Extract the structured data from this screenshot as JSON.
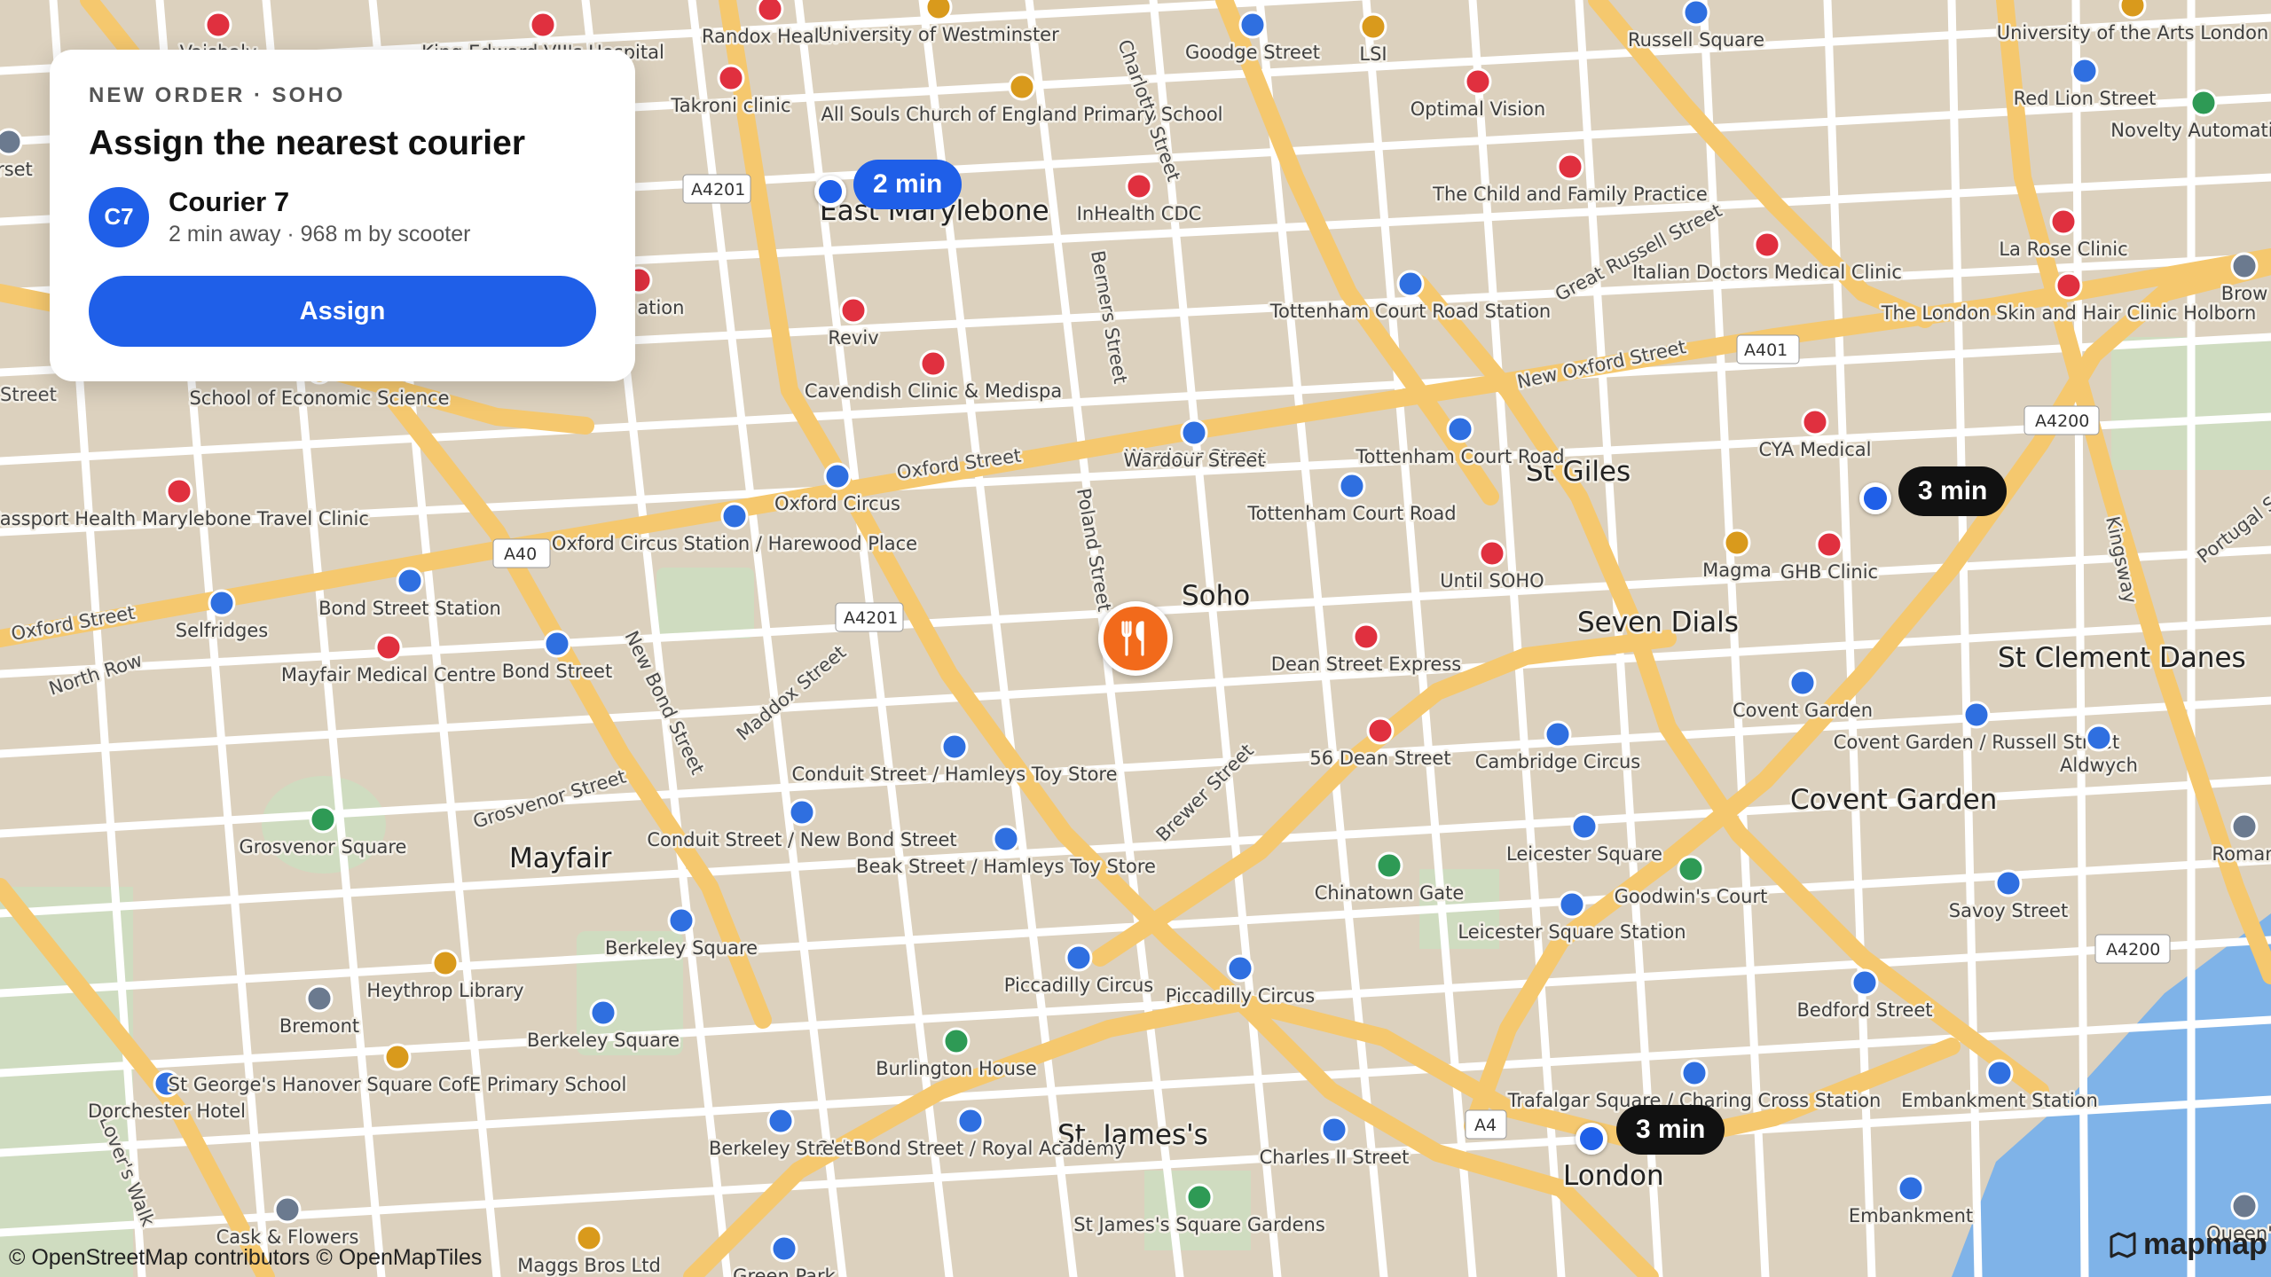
{
  "order_card": {
    "eyebrow": "NEW ORDER · SOHO",
    "title": "Assign the nearest courier",
    "courier": {
      "initials": "C7",
      "name": "Courier 7",
      "detail": "2 min away · 968 m by scooter"
    },
    "assign_label": "Assign"
  },
  "markers": {
    "restaurant_icon": "fork-knife-icon",
    "couriers": [
      {
        "eta": "2 min",
        "style": "selected",
        "color": "#1f5fe8"
      },
      {
        "eta": "3 min",
        "style": "default",
        "color": "#111111"
      },
      {
        "eta": "3 min",
        "style": "default",
        "color": "#111111"
      }
    ]
  },
  "map": {
    "areas": [
      "Soho",
      "Mayfair",
      "St Giles",
      "Seven Dials",
      "Covent Garden",
      "St Clement Danes",
      "St. James's",
      "London",
      "East Marylebone"
    ],
    "streets": [
      "Oxford Street",
      "New Oxford Street",
      "Great Russell Street",
      "Charlotte Street",
      "Berners Street",
      "Wardour Street",
      "Poland Street",
      "Brewer Street",
      "Maddox Street",
      "Grosvenor Street",
      "New Bond Street",
      "North Row",
      "Kingsway",
      "Lover's Walk",
      "Portugal St",
      "Street"
    ],
    "road_shields": [
      "A4201",
      "A40",
      "A4201",
      "A401",
      "A4200",
      "A4200",
      "A4"
    ],
    "stations": [
      "Goodge Street",
      "Tottenham Court Road Station",
      "Wardour Street",
      "Tottenham Court Road",
      "Tottenham Court Road",
      "Oxford Circus",
      "Oxford Circus Station / Harewood Place",
      "Bond Street Station",
      "Bond Street",
      "Conduit Street / Hamleys Toy Store",
      "Conduit Street / New Bond Street",
      "Beak Street / Hamleys Toy Store",
      "Piccadilly Circus",
      "Piccadilly Circus",
      "Cambridge Circus",
      "Leicester Square",
      "Leicester Square Station",
      "Covent Garden",
      "Covent Garden / Russell Street",
      "Aldwych",
      "Savoy Street",
      "Bedford Street",
      "Embankment Station",
      "Embankment",
      "Trafalgar Square / Charing Cross Station",
      "Charles II Street",
      "Old Bond Street / Royal Academy",
      "Berkeley Street",
      "Berkeley Square",
      "Berkeley Square",
      "Dorchester Hotel",
      "Selfridges",
      "Red Lion Street",
      "Russell Square",
      "Green Park"
    ],
    "health": [
      "Randox Health",
      "King Edward VII's Hospital",
      "Vaishaly",
      "Takroni clinic",
      "InHealth CDC",
      "Reviv",
      "Cavendish Clinic & Medispa",
      "Passport Health Marylebone Travel Clinic",
      "Mayfair Medical Centre",
      "Optimal Vision",
      "The Child and Family Practice",
      "Italian Doctors Medical Clinic",
      "La Rose Clinic",
      "The London Skin and Hair Clinic Holborn",
      "CYA Medical",
      "GHB Clinic",
      "Until SOHO",
      "Dean Street Express",
      "56 Dean Street",
      "Hair ation"
    ],
    "education": [
      "University of Westminster",
      "LSI",
      "All Souls Church of England Primary School",
      "Magma",
      "Heythrop Library",
      "St George's Hanover Square CofE Primary School",
      "Maggs Bros Ltd",
      "University of the Arts London",
      "School of Economic Science"
    ],
    "parks": [
      "Grosvenor Square",
      "Chinatown Gate",
      "Goodwin's Court",
      "Burlington House",
      "St James's Square Gardens",
      "Novelty Automation"
    ],
    "misc": [
      "Bremont",
      "Cask & Flowers",
      "Brow",
      "Roman",
      "Queen's",
      "orset"
    ]
  },
  "attribution": "© OpenStreetMap contributors © OpenMapTiles",
  "brand": {
    "name": "mapmap",
    "icon": "mapmap-logo-icon"
  },
  "colors": {
    "accent": "#1f5fe8",
    "restaurant": "#f26a1b",
    "health": "#e0303f",
    "station": "#2f6fe0",
    "education": "#d99a1c",
    "park": "#2e9a55",
    "major_road": "#f5c86e",
    "water": "#7fb3e8"
  }
}
